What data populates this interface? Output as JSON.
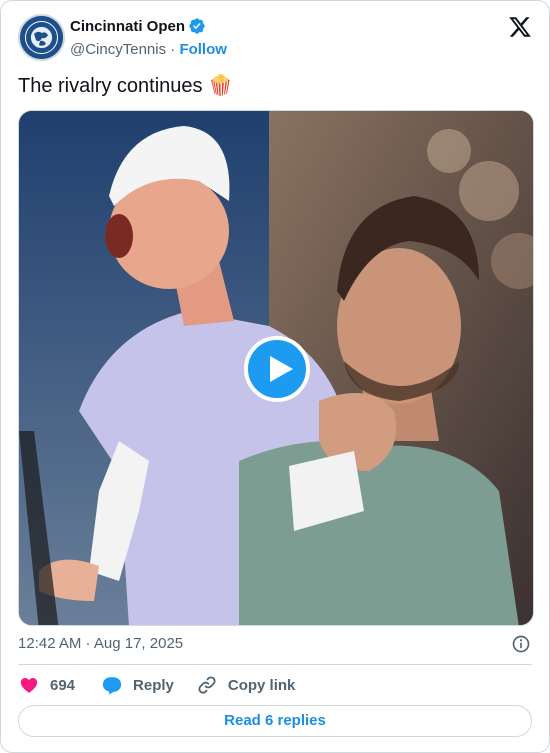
{
  "author": {
    "display_name": "Cincinnati Open",
    "handle": "@CincyTennis",
    "separator": "·",
    "follow_label": "Follow",
    "avatar_text": "CINCINNATI OPEN",
    "verified": true
  },
  "tweet": {
    "text": "The rivalry continues",
    "emoji": "🍿"
  },
  "media": {
    "type": "video",
    "play_icon": "play-icon"
  },
  "meta": {
    "timestamp": "12:42 AM · Aug 17, 2025"
  },
  "actions": {
    "like_count": "694",
    "reply_label": "Reply",
    "copy_link_label": "Copy link"
  },
  "read_replies_label": "Read 6 replies",
  "colors": {
    "accent": "#1d9bf0",
    "link": "#1d8fe0",
    "like": "#f91880",
    "muted": "#536471",
    "text": "#0f1419",
    "border": "#cfd9de"
  }
}
